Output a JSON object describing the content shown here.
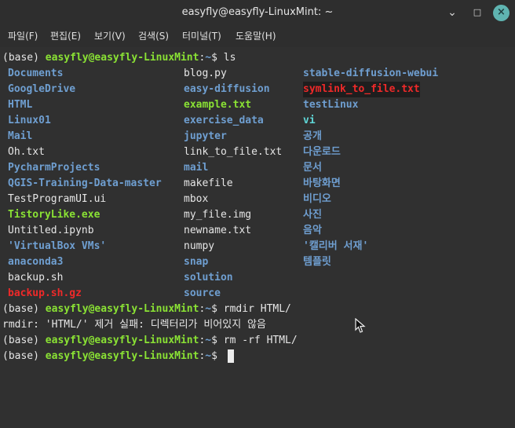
{
  "window": {
    "title": "easyfly@easyfly-LinuxMint: ~"
  },
  "controls": {
    "minimize": "⌄",
    "maximize": "□",
    "close": "×"
  },
  "menu": [
    "파일(F)",
    "편집(E)",
    "보기(V)",
    "검색(S)",
    "터미널(T)",
    "도움말(H)"
  ],
  "prompt": {
    "env": "(base) ",
    "user": "easyfly@easyfly-LinuxMint",
    "colon": ":",
    "path": "~",
    "dollar": "$ "
  },
  "commands": {
    "ls": "ls",
    "rmdir": "rmdir HTML/",
    "rmrf": "rm -rf HTML/"
  },
  "error_line": "rmdir: 'HTML/' 제거 실패: 디렉터리가 비어있지 않음",
  "listing": {
    "col1": [
      {
        "name": "Documents",
        "style": "cyan"
      },
      {
        "name": "GoogleDrive",
        "style": "cyan"
      },
      {
        "name": "HTML",
        "style": "cyan"
      },
      {
        "name": "Linux01",
        "style": "cyan"
      },
      {
        "name": "Mail",
        "style": "cyan"
      },
      {
        "name": "Oh.txt",
        "style": "white"
      },
      {
        "name": "PycharmProjects",
        "style": "cyan"
      },
      {
        "name": "QGIS-Training-Data-master",
        "style": "cyan"
      },
      {
        "name": "TestProgramUI.ui",
        "style": "white"
      },
      {
        "name": "TistoryLike.exe",
        "style": "green"
      },
      {
        "name": "Untitled.ipynb",
        "style": "white"
      },
      {
        "name": "'VirtualBox VMs'",
        "style": "cyan"
      },
      {
        "name": "anaconda3",
        "style": "cyan"
      },
      {
        "name": "backup.sh",
        "style": "white"
      },
      {
        "name": "backup.sh.gz",
        "style": "red"
      }
    ],
    "col2": [
      {
        "name": "blog.py",
        "style": "white"
      },
      {
        "name": "easy-diffusion",
        "style": "cyan"
      },
      {
        "name": "example.txt",
        "style": "green"
      },
      {
        "name": "exercise_data",
        "style": "cyan"
      },
      {
        "name": "jupyter",
        "style": "cyan"
      },
      {
        "name": "link_to_file.txt",
        "style": "white"
      },
      {
        "name": "mail",
        "style": "cyan"
      },
      {
        "name": "makefile",
        "style": "white"
      },
      {
        "name": "mbox",
        "style": "white"
      },
      {
        "name": "my_file.img",
        "style": "white"
      },
      {
        "name": "newname.txt",
        "style": "white"
      },
      {
        "name": "numpy",
        "style": "white"
      },
      {
        "name": "snap",
        "style": "cyan"
      },
      {
        "name": "solution",
        "style": "cyan"
      },
      {
        "name": "source",
        "style": "cyan"
      }
    ],
    "col3": [
      {
        "name": "stable-diffusion-webui",
        "style": "cyan"
      },
      {
        "name": "symlink_to_file.txt",
        "style": "redbg"
      },
      {
        "name": "testLinux",
        "style": "cyan"
      },
      {
        "name": "vi",
        "style": "teal"
      },
      {
        "name": "공개",
        "style": "cyan"
      },
      {
        "name": "다운로드",
        "style": "cyan"
      },
      {
        "name": "문서",
        "style": "cyan"
      },
      {
        "name": "바탕화면",
        "style": "cyan"
      },
      {
        "name": "비디오",
        "style": "cyan"
      },
      {
        "name": "사진",
        "style": "cyan"
      },
      {
        "name": "음악",
        "style": "cyan"
      },
      {
        "name": "'캘리버 서재'",
        "style": "cyan"
      },
      {
        "name": "템플릿",
        "style": "cyan"
      }
    ]
  }
}
